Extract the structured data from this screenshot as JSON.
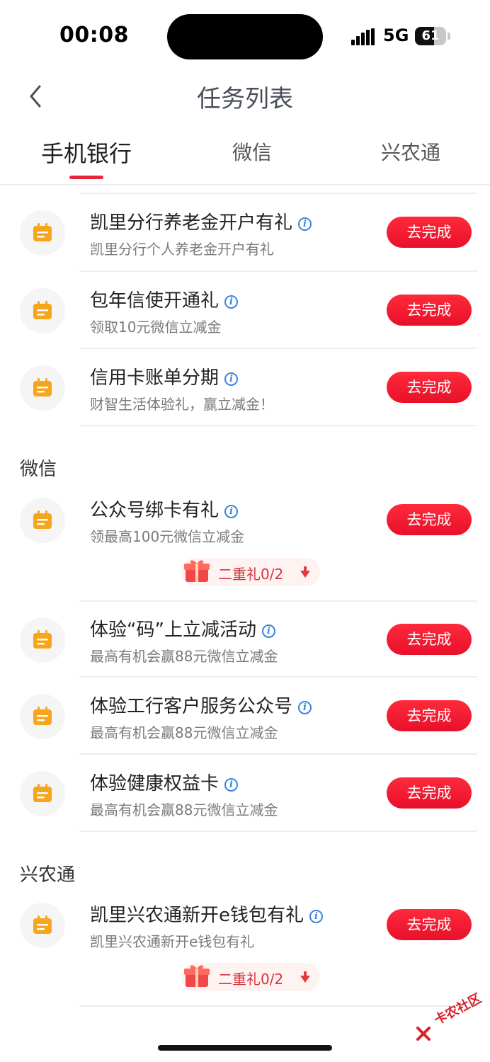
{
  "status_bar": {
    "time": "00:08",
    "network": "5G",
    "battery": "61",
    "battery_level": 0.61
  },
  "nav": {
    "title": "任务列表",
    "back_icon": "chevron-left-icon"
  },
  "tabs": [
    {
      "label": "手机银行",
      "active": true
    },
    {
      "label": "微信",
      "active": false
    },
    {
      "label": "兴农通",
      "active": false
    }
  ],
  "sections": {
    "bank_tasks": [
      {
        "title": "凯里分行养老金开户有礼",
        "desc": "凯里分行个人养老金开户有礼",
        "button": "去完成"
      },
      {
        "title": "包年信使开通礼",
        "desc": "领取10元微信立减金",
        "button": "去完成"
      },
      {
        "title": "信用卡账单分期",
        "desc": "财智生活体验礼，赢立减金！",
        "button": "去完成"
      }
    ],
    "wechat": {
      "title": "微信",
      "tasks": [
        {
          "title": "公众号绑卡有礼",
          "desc": "领最高100元微信立减金",
          "button": "去完成",
          "gift": "二重礼0/2"
        },
        {
          "title": "体验“码”上立减活动",
          "desc": "最高有机会赢88元微信立减金",
          "button": "去完成"
        },
        {
          "title": "体验工行客户服务公众号",
          "desc": "最高有机会赢88元微信立减金",
          "button": "去完成"
        },
        {
          "title": "体验健康权益卡",
          "desc": "最高有机会赢88元微信立减金",
          "button": "去完成"
        }
      ]
    },
    "xingnongtong": {
      "title": "兴农通",
      "tasks": [
        {
          "title": "凯里兴农通新开e钱包有礼",
          "desc": "凯里兴农通新开e钱包有礼",
          "button": "去完成",
          "gift": "二重礼0/2"
        }
      ]
    }
  },
  "watermark": "卡农社区",
  "colors": {
    "accent": "#e8263a",
    "icon_orange": "#f7a51c",
    "info_blue": "#3a84e0"
  }
}
